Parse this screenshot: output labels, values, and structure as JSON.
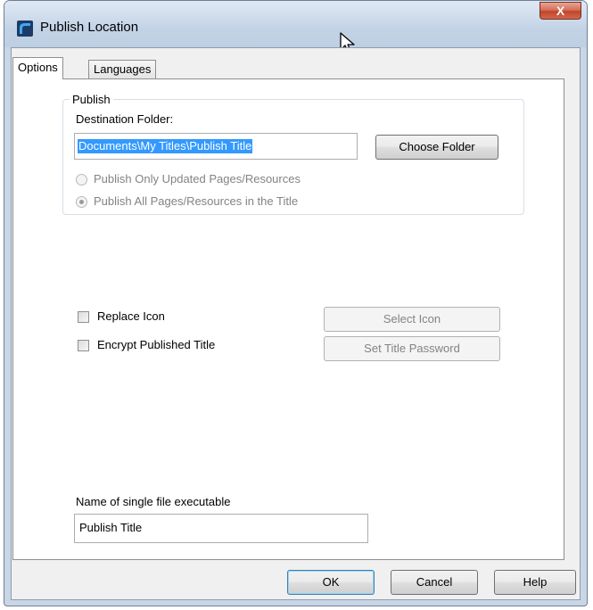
{
  "window": {
    "title": "Publish Location",
    "close_label": "X"
  },
  "tabs": [
    {
      "label": "Options",
      "active": true
    },
    {
      "label": "Languages",
      "active": false
    }
  ],
  "publish_group": {
    "legend": "Publish",
    "destination_label": "Destination Folder:",
    "destination_value": "Documents\\My Titles\\Publish Title",
    "choose_folder_label": "Choose Folder",
    "radio_updated_label": "Publish Only Updated Pages/Resources",
    "radio_all_label": "Publish All Pages/Resources in the Title",
    "selected_radio": "all"
  },
  "options": {
    "replace_icon_label": "Replace Icon",
    "replace_icon_checked": false,
    "select_icon_label": "Select Icon",
    "encrypt_label": "Encrypt Published Title",
    "encrypt_checked": false,
    "set_password_label": "Set Title Password"
  },
  "executable": {
    "label": "Name of single file executable",
    "value": "Publish Title"
  },
  "footer": {
    "ok_label": "OK",
    "cancel_label": "Cancel",
    "help_label": "Help"
  }
}
